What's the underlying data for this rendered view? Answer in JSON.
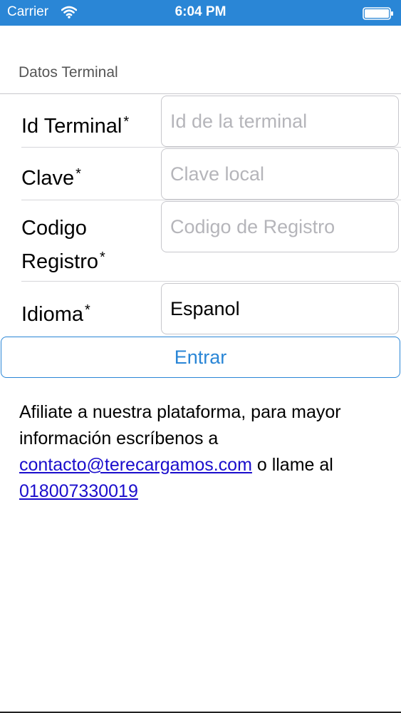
{
  "status_bar": {
    "carrier": "Carrier",
    "time": "6:04 PM",
    "background": "#2a86d6"
  },
  "section": {
    "title": "Datos Terminal"
  },
  "form": {
    "required_mark": "*",
    "terminal_id": {
      "label": "Id Terminal",
      "value": "",
      "placeholder": "Id de la terminal"
    },
    "password": {
      "label": "Clave",
      "value": "",
      "placeholder": "Clave local"
    },
    "registration_code": {
      "label_line1": "Codigo",
      "label_line2": "Registro",
      "value": "",
      "placeholder": "Codigo de Registro"
    },
    "language": {
      "label": "Idioma",
      "value": "Espanol"
    }
  },
  "submit": {
    "label": "Entrar",
    "color": "#2a86d6"
  },
  "info": {
    "text_before": "Afiliate a nuestra plataforma, para mayor información escríbenos a ",
    "email": "contacto@terecargamos.com",
    "text_middle": " o llame al ",
    "phone": "018007330019",
    "link_color": "#1a0dcc"
  }
}
